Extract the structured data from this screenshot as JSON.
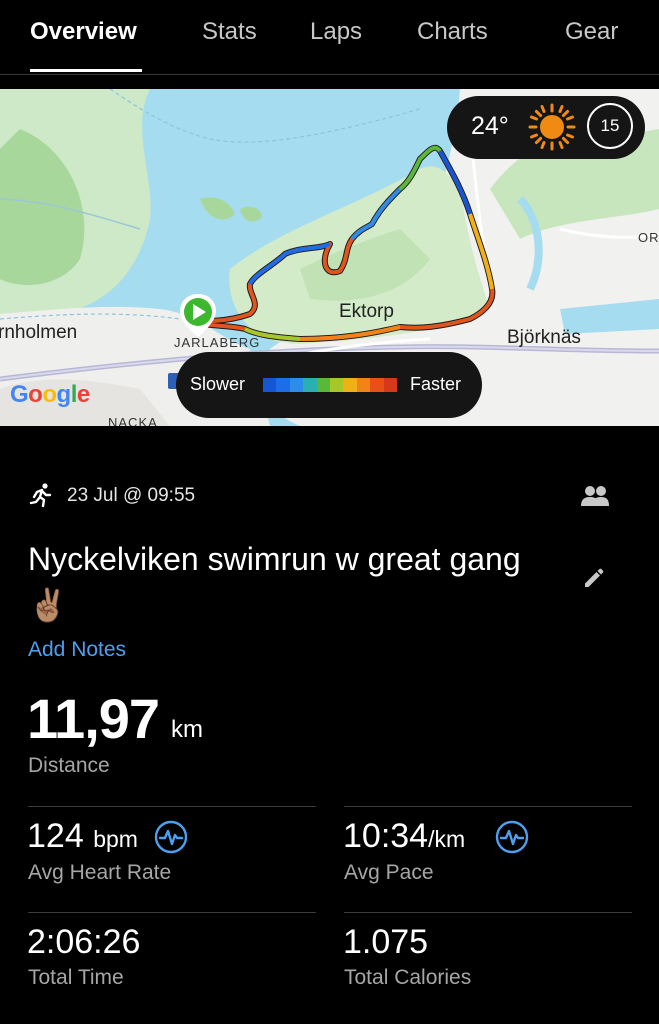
{
  "tabs": [
    {
      "label": "Overview",
      "active": true
    },
    {
      "label": "Stats",
      "active": false
    },
    {
      "label": "Laps",
      "active": false
    },
    {
      "label": "Charts",
      "active": false
    },
    {
      "label": "Gear",
      "active": false
    }
  ],
  "map": {
    "labels": {
      "rnholmen": "rnholmen",
      "jarlaberg": "JARLABERG",
      "ektorp": "Ektorp",
      "bjorknas": "Björknäs",
      "nacka": "NACKA",
      "or": "OR"
    },
    "google_logo": "Google",
    "weather": {
      "temperature": "24°",
      "condition_icon": "sun-icon",
      "clock_value": "15"
    },
    "legend": {
      "slow_label": "Slower",
      "fast_label": "Faster",
      "colors": [
        "#1556d6",
        "#1e6de8",
        "#2d8ce8",
        "#2ab0b0",
        "#58b83c",
        "#a6c72a",
        "#f0b018",
        "#f08418",
        "#e85018",
        "#d43a18"
      ]
    }
  },
  "activity": {
    "type_icon": "running-icon",
    "date": "23 Jul @ 09:55",
    "title": "Nyckelviken swimrun w great gang ✌🏽",
    "add_notes": "Add Notes"
  },
  "distance": {
    "value": "11,97",
    "unit": "km",
    "label": "Distance"
  },
  "stats": {
    "heart_rate": {
      "value": "124",
      "unit": "bpm",
      "label": "Avg Heart Rate"
    },
    "pace": {
      "value": "10:34",
      "unit": "/km",
      "label": "Avg Pace"
    },
    "time": {
      "value": "2:06:26",
      "label": "Total Time"
    },
    "calories": {
      "value": "1.075",
      "label": "Total Calories"
    }
  },
  "colors": {
    "accent": "#4d9ff0",
    "background": "#000000"
  }
}
